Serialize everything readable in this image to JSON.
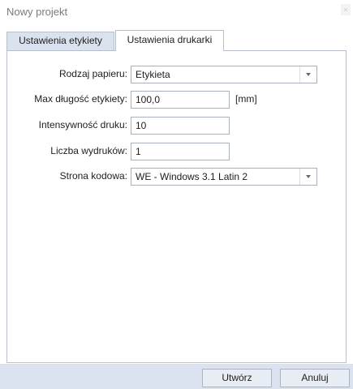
{
  "window": {
    "title": "Nowy projekt",
    "close_glyph": "×"
  },
  "tabs": [
    {
      "label": "Ustawienia etykiety",
      "active": false
    },
    {
      "label": "Ustawienia drukarki",
      "active": true
    }
  ],
  "form": {
    "paper_type": {
      "label": "Rodzaj papieru:",
      "value": "Etykieta"
    },
    "max_label_length": {
      "label": "Max długość etykiety:",
      "value": "100,0",
      "unit": "[mm]"
    },
    "print_intensity": {
      "label": "Intensywność druku:",
      "value": "10"
    },
    "copies": {
      "label": "Liczba wydruków:",
      "value": "1"
    },
    "code_page": {
      "label": "Strona kodowa:",
      "value": "WE - Windows 3.1 Latin 2"
    }
  },
  "buttons": {
    "create": "Utwórz",
    "cancel": "Anuluj"
  },
  "icons": {
    "close": "close-icon",
    "dropdown": "chevron-down-icon"
  },
  "colors": {
    "tab_bar": "#d9e2ee",
    "border": "#b7bfc9",
    "footer": "#d9e2ee"
  }
}
